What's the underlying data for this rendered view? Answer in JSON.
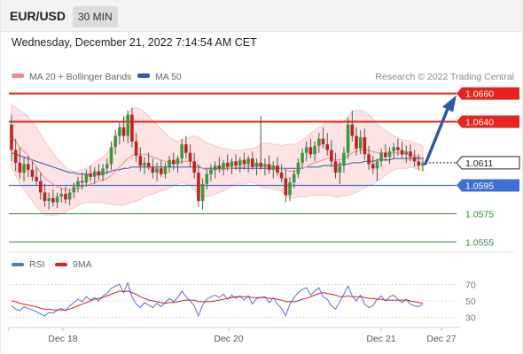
{
  "header": {
    "symbol": "EUR/USD",
    "period": "30 MIN",
    "datetime": "Wednesday, December 21, 2022 7:14:54 AM CET"
  },
  "legend": {
    "ma20": "MA 20 + Bollinger Bands",
    "ma50": "MA 50",
    "credit": "Research © 2022 Trading Central",
    "ma20_color": "#f08a8a",
    "ma50_color": "#2d5aa8"
  },
  "chart_data": [
    {
      "type": "candlestick",
      "x_ticks": [
        "Dec 18",
        "Dec 20",
        "Dec 21",
        "Dec 27"
      ],
      "ylim": [
        1.0549,
        1.0666
      ],
      "last_price": "1.0611",
      "levels": [
        {
          "label": "1.0660",
          "value": 1.066,
          "kind": "resistance",
          "color": "#e8221c"
        },
        {
          "label": "1.0640",
          "value": 1.064,
          "kind": "resistance",
          "color": "#e8221c"
        },
        {
          "label": "1.0611",
          "value": 1.0611,
          "kind": "last",
          "color": "#222222"
        },
        {
          "label": "1.0595",
          "value": 1.0595,
          "kind": "pivot",
          "color": "#3f6fd6"
        },
        {
          "label": "1.0575",
          "value": 1.0575,
          "kind": "support",
          "color": "#2e8b2e"
        },
        {
          "label": "1.0555",
          "value": 1.0555,
          "kind": "support",
          "color": "#2e8b2e"
        }
      ],
      "forecast_arrow": {
        "from": 1.0611,
        "to": 1.066,
        "color": "#2d5aa8"
      },
      "ohlc": [
        [
          1.0638,
          1.0645,
          1.0612,
          1.062
        ],
        [
          1.062,
          1.0628,
          1.0605,
          1.0611
        ],
        [
          1.0611,
          1.0622,
          1.06,
          1.0604
        ],
        [
          1.0604,
          1.0615,
          1.0598,
          1.061
        ],
        [
          1.061,
          1.0616,
          1.0601,
          1.0606
        ],
        [
          1.0606,
          1.0612,
          1.0598,
          1.0601
        ],
        [
          1.0601,
          1.0608,
          1.0595,
          1.0598
        ],
        [
          1.0598,
          1.0604,
          1.0585,
          1.059
        ],
        [
          1.059,
          1.0596,
          1.058,
          1.0584
        ],
        [
          1.0584,
          1.059,
          1.0578,
          1.0586
        ],
        [
          1.0586,
          1.0592,
          1.058,
          1.0583
        ],
        [
          1.0583,
          1.059,
          1.0579,
          1.0587
        ],
        [
          1.0587,
          1.0593,
          1.0583,
          1.0589
        ],
        [
          1.0589,
          1.0594,
          1.0582,
          1.0585
        ],
        [
          1.0585,
          1.0592,
          1.0581,
          1.059
        ],
        [
          1.059,
          1.0597,
          1.0586,
          1.0594
        ],
        [
          1.0594,
          1.0601,
          1.059,
          1.0598
        ],
        [
          1.0598,
          1.0604,
          1.0592,
          1.0597
        ],
        [
          1.0597,
          1.0606,
          1.0594,
          1.0603
        ],
        [
          1.0603,
          1.0609,
          1.0598,
          1.0601
        ],
        [
          1.0601,
          1.0608,
          1.0596,
          1.0605
        ],
        [
          1.0605,
          1.061,
          1.0599,
          1.0602
        ],
        [
          1.0602,
          1.061,
          1.0598,
          1.0607
        ],
        [
          1.0607,
          1.0614,
          1.0603,
          1.061
        ],
        [
          1.061,
          1.0626,
          1.0606,
          1.0622
        ],
        [
          1.0622,
          1.0634,
          1.0617,
          1.063
        ],
        [
          1.063,
          1.064,
          1.0624,
          1.0636
        ],
        [
          1.0636,
          1.0644,
          1.0626,
          1.063
        ],
        [
          1.063,
          1.0648,
          1.0625,
          1.0645
        ],
        [
          1.0645,
          1.065,
          1.0622,
          1.0626
        ],
        [
          1.0626,
          1.0632,
          1.0612,
          1.0616
        ],
        [
          1.0616,
          1.0622,
          1.0605,
          1.0609
        ],
        [
          1.0609,
          1.0615,
          1.0603,
          1.0611
        ],
        [
          1.0611,
          1.0618,
          1.0606,
          1.0608
        ],
        [
          1.0608,
          1.0614,
          1.06,
          1.0604
        ],
        [
          1.0604,
          1.0611,
          1.0598,
          1.0607
        ],
        [
          1.0607,
          1.0613,
          1.0601,
          1.0603
        ],
        [
          1.0603,
          1.0611,
          1.06,
          1.0608
        ],
        [
          1.0608,
          1.0616,
          1.0604,
          1.0613
        ],
        [
          1.0613,
          1.0618,
          1.0606,
          1.061
        ],
        [
          1.061,
          1.0616,
          1.0604,
          1.0614
        ],
        [
          1.0614,
          1.0628,
          1.061,
          1.0624
        ],
        [
          1.0624,
          1.063,
          1.0614,
          1.0618
        ],
        [
          1.0618,
          1.0624,
          1.0608,
          1.0612
        ],
        [
          1.0612,
          1.0618,
          1.06,
          1.0604
        ],
        [
          1.0604,
          1.061,
          1.058,
          1.0584
        ],
        [
          1.0584,
          1.06,
          1.0578,
          1.0596
        ],
        [
          1.0596,
          1.0606,
          1.0592,
          1.0603
        ],
        [
          1.0603,
          1.061,
          1.0598,
          1.0606
        ],
        [
          1.0606,
          1.0612,
          1.06,
          1.0609
        ],
        [
          1.0609,
          1.0615,
          1.0604,
          1.0607
        ],
        [
          1.0607,
          1.0613,
          1.0602,
          1.0611
        ],
        [
          1.0611,
          1.0617,
          1.0605,
          1.0608
        ],
        [
          1.0608,
          1.0614,
          1.0603,
          1.0612
        ],
        [
          1.0612,
          1.0617,
          1.0606,
          1.0609
        ],
        [
          1.0609,
          1.0615,
          1.0604,
          1.0613
        ],
        [
          1.0613,
          1.0618,
          1.0606,
          1.061
        ],
        [
          1.061,
          1.0616,
          1.0604,
          1.0614
        ],
        [
          1.0614,
          1.0619,
          1.0606,
          1.0608
        ],
        [
          1.0608,
          1.0614,
          1.0602,
          1.0611
        ],
        [
          1.0611,
          1.0644,
          1.0606,
          1.0608
        ],
        [
          1.0608,
          1.0614,
          1.0602,
          1.061
        ],
        [
          1.061,
          1.0616,
          1.0603,
          1.0606
        ],
        [
          1.0606,
          1.0612,
          1.06,
          1.0609
        ],
        [
          1.0609,
          1.0615,
          1.0602,
          1.0604
        ],
        [
          1.0604,
          1.061,
          1.0597,
          1.06
        ],
        [
          1.06,
          1.0606,
          1.0583,
          1.0588
        ],
        [
          1.0588,
          1.0601,
          1.0584,
          1.0597
        ],
        [
          1.0597,
          1.0606,
          1.0593,
          1.0603
        ],
        [
          1.0603,
          1.0614,
          1.06,
          1.0611
        ],
        [
          1.0611,
          1.0621,
          1.0607,
          1.0618
        ],
        [
          1.0618,
          1.0626,
          1.0612,
          1.0622
        ],
        [
          1.0622,
          1.0628,
          1.0614,
          1.0617
        ],
        [
          1.0617,
          1.0626,
          1.0612,
          1.0623
        ],
        [
          1.0623,
          1.0632,
          1.0618,
          1.0628
        ],
        [
          1.0628,
          1.0636,
          1.0621,
          1.0624
        ],
        [
          1.0624,
          1.0632,
          1.0616,
          1.062
        ],
        [
          1.062,
          1.0627,
          1.0608,
          1.0612
        ],
        [
          1.0612,
          1.0618,
          1.06,
          1.0604
        ],
        [
          1.0604,
          1.0612,
          1.0596,
          1.0609
        ],
        [
          1.0609,
          1.0622,
          1.0604,
          1.0618
        ],
        [
          1.0618,
          1.0643,
          1.0614,
          1.0638
        ],
        [
          1.0638,
          1.0648,
          1.0626,
          1.063
        ],
        [
          1.063,
          1.0636,
          1.0616,
          1.0621
        ],
        [
          1.0621,
          1.0634,
          1.0617,
          1.0629
        ],
        [
          1.0629,
          1.0635,
          1.0613,
          1.0617
        ],
        [
          1.0617,
          1.0623,
          1.0606,
          1.061
        ],
        [
          1.061,
          1.0616,
          1.0603,
          1.0607
        ],
        [
          1.0607,
          1.0614,
          1.0598,
          1.0612
        ],
        [
          1.0612,
          1.0621,
          1.0608,
          1.0618
        ],
        [
          1.0618,
          1.0624,
          1.0612,
          1.0615
        ],
        [
          1.0615,
          1.0622,
          1.061,
          1.0619
        ],
        [
          1.0619,
          1.0625,
          1.0614,
          1.0622
        ],
        [
          1.0622,
          1.0628,
          1.0616,
          1.062
        ],
        [
          1.062,
          1.0626,
          1.0614,
          1.0617
        ],
        [
          1.0617,
          1.0623,
          1.0611,
          1.0619
        ],
        [
          1.0619,
          1.0624,
          1.0612,
          1.0615
        ],
        [
          1.0615,
          1.062,
          1.0608,
          1.0612
        ],
        [
          1.0612,
          1.0617,
          1.0606,
          1.0609
        ],
        [
          1.0609,
          1.0615,
          1.0605,
          1.0611
        ]
      ],
      "ma20": [
        1.063,
        1.0626,
        1.0622,
        1.0619,
        1.0616,
        1.0612,
        1.0608,
        1.0604,
        1.06,
        1.0598,
        1.0596,
        1.0594,
        1.0593,
        1.0592,
        1.0592,
        1.0592,
        1.0593,
        1.0594,
        1.0595,
        1.0596,
        1.0597,
        1.0598,
        1.0599,
        1.06,
        1.0602,
        1.0605,
        1.0608,
        1.0611,
        1.0614,
        1.0616,
        1.0617,
        1.0617,
        1.0617,
        1.0616,
        1.0615,
        1.0614,
        1.0613,
        1.0612,
        1.0611,
        1.0611,
        1.0611,
        1.0612,
        1.0612,
        1.0612,
        1.0611,
        1.0609,
        1.0607,
        1.0606,
        1.0606,
        1.0606,
        1.0606,
        1.0606,
        1.0607,
        1.0607,
        1.0608,
        1.0608,
        1.0608,
        1.0609,
        1.0609,
        1.0609,
        1.0609,
        1.0609,
        1.0609,
        1.0608,
        1.0608,
        1.0607,
        1.0606,
        1.0605,
        1.0605,
        1.0606,
        1.0607,
        1.0608,
        1.061,
        1.0611,
        1.0612,
        1.0613,
        1.0614,
        1.0614,
        1.0613,
        1.0613,
        1.0614,
        1.0616,
        1.0618,
        1.0619,
        1.062,
        1.062,
        1.062,
        1.0619,
        1.0618,
        1.0618,
        1.0618,
        1.0618,
        1.0618,
        1.0618,
        1.0617,
        1.0617,
        1.0617,
        1.0616,
        1.0615,
        1.0614
      ],
      "bb_width": [
        0.0022,
        0.0024,
        0.0026,
        0.0027,
        0.0028,
        0.0028,
        0.0028,
        0.0027,
        0.0026,
        0.0024,
        0.0022,
        0.002,
        0.0018,
        0.0016,
        0.0014,
        0.0013,
        0.0012,
        0.0012,
        0.0012,
        0.0013,
        0.0014,
        0.0015,
        0.0016,
        0.0018,
        0.002,
        0.0024,
        0.0027,
        0.003,
        0.0032,
        0.0033,
        0.0033,
        0.0032,
        0.003,
        0.0028,
        0.0026,
        0.0024,
        0.0022,
        0.002,
        0.0018,
        0.0016,
        0.0015,
        0.0015,
        0.0016,
        0.0017,
        0.0019,
        0.002,
        0.002,
        0.0019,
        0.0018,
        0.0017,
        0.0016,
        0.0015,
        0.0014,
        0.0013,
        0.0012,
        0.0012,
        0.0012,
        0.0012,
        0.0012,
        0.0013,
        0.0015,
        0.0016,
        0.0016,
        0.0016,
        0.0016,
        0.0016,
        0.0018,
        0.0019,
        0.0019,
        0.0019,
        0.002,
        0.0021,
        0.0022,
        0.0023,
        0.0024,
        0.0025,
        0.0026,
        0.0026,
        0.0026,
        0.0026,
        0.0026,
        0.0028,
        0.0029,
        0.0029,
        0.0028,
        0.0027,
        0.0025,
        0.0023,
        0.002,
        0.0018,
        0.0016,
        0.0014,
        0.0012,
        0.0011,
        0.001,
        0.001,
        0.0009,
        0.0009,
        0.0009,
        0.0009
      ],
      "ma50": [
        1.0618,
        1.0617,
        1.0616,
        1.0615,
        1.0614,
        1.0613,
        1.0612,
        1.0611,
        1.061,
        1.0609,
        1.0608,
        1.0607,
        1.0606,
        1.0605,
        1.0604,
        1.0604,
        1.0603,
        1.0603,
        1.0603,
        1.0603,
        1.0603,
        1.0603,
        1.0604,
        1.0604,
        1.0605,
        1.0606,
        1.0606,
        1.0607,
        1.0607,
        1.0608,
        1.0608,
        1.0608,
        1.0608,
        1.0608,
        1.0608,
        1.0608,
        1.0608,
        1.0608,
        1.0608,
        1.0608,
        1.0608,
        1.0608,
        1.0608,
        1.0608,
        1.0608,
        1.0608,
        1.0607,
        1.0607,
        1.0607,
        1.0607,
        1.0607,
        1.0607,
        1.0607,
        1.0607,
        1.0607,
        1.0607,
        1.0607,
        1.0607,
        1.0607,
        1.0607,
        1.0607,
        1.0607,
        1.0607,
        1.0607,
        1.0607,
        1.0607,
        1.0607,
        1.0607,
        1.0607,
        1.0607,
        1.0607,
        1.0608,
        1.0608,
        1.0608,
        1.0608,
        1.0609,
        1.0609,
        1.0609,
        1.0609,
        1.061,
        1.061,
        1.061,
        1.0611,
        1.0611,
        1.0611,
        1.0612,
        1.0612,
        1.0612,
        1.0613,
        1.0613,
        1.0613,
        1.0613,
        1.0614,
        1.0614,
        1.0614,
        1.0614,
        1.0614,
        1.0614,
        1.0614,
        1.0614
      ]
    },
    {
      "type": "line",
      "legend": [
        "RSI",
        "9MA"
      ],
      "colors": [
        "#4a78d8",
        "#e02020"
      ],
      "ylim": [
        20,
        80
      ],
      "y_ticks": [
        {
          "label": "70",
          "value": 70
        },
        {
          "label": "50",
          "value": 50
        },
        {
          "label": "30",
          "value": 30
        }
      ],
      "rsi": [
        44,
        40,
        38,
        43,
        41,
        39,
        37,
        34,
        32,
        36,
        35,
        39,
        41,
        38,
        44,
        48,
        52,
        49,
        55,
        51,
        54,
        50,
        56,
        59,
        65,
        68,
        70,
        60,
        72,
        55,
        46,
        42,
        48,
        45,
        42,
        47,
        43,
        48,
        53,
        49,
        54,
        62,
        55,
        50,
        44,
        32,
        45,
        52,
        55,
        57,
        54,
        58,
        52,
        57,
        53,
        56,
        51,
        56,
        46,
        53,
        54,
        55,
        48,
        54,
        46,
        41,
        32,
        46,
        54,
        60,
        64,
        66,
        57,
        62,
        66,
        55,
        52,
        44,
        40,
        49,
        58,
        68,
        56,
        50,
        57,
        46,
        42,
        44,
        52,
        56,
        50,
        55,
        57,
        52,
        48,
        52,
        46,
        44,
        43,
        46
      ],
      "ma9": [
        50,
        49,
        47,
        46,
        45,
        44,
        43,
        41,
        40,
        40,
        39,
        39,
        39,
        39,
        40,
        42,
        44,
        46,
        48,
        50,
        52,
        53,
        54,
        56,
        58,
        60,
        62,
        61,
        62,
        60,
        58,
        55,
        53,
        51,
        50,
        49,
        48,
        47,
        48,
        48,
        49,
        50,
        51,
        51,
        51,
        49,
        49,
        49,
        49,
        50,
        51,
        52,
        53,
        54,
        55,
        55,
        55,
        55,
        54,
        54,
        54,
        54,
        53,
        53,
        52,
        51,
        49,
        49,
        49,
        50,
        52,
        53,
        55,
        57,
        59,
        60,
        59,
        58,
        57,
        55,
        55,
        56,
        55,
        55,
        55,
        54,
        53,
        53,
        52,
        52,
        51,
        51,
        51,
        51,
        51,
        51,
        50,
        49,
        48,
        47
      ]
    }
  ]
}
